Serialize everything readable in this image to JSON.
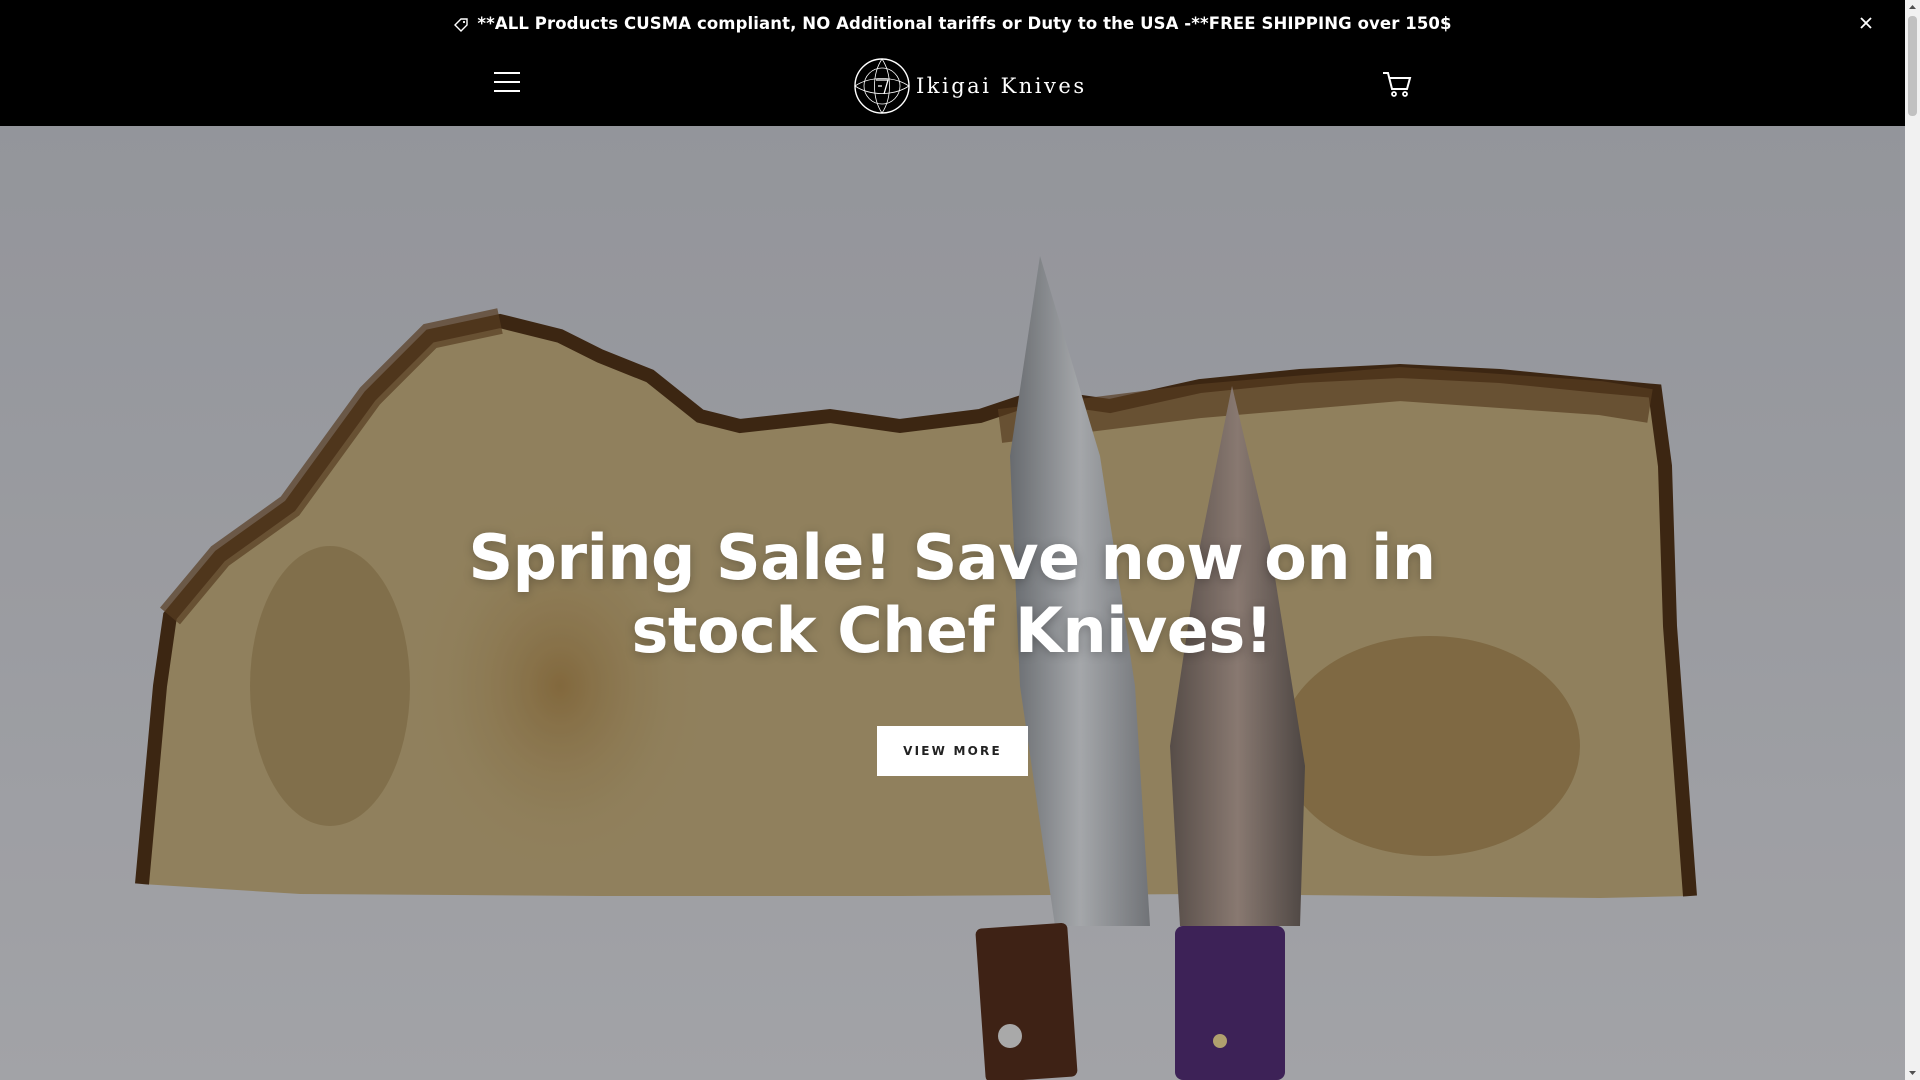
{
  "announcement": {
    "icon": "tag-icon",
    "text": "**ALL Products CUSMA compliant, NO Additional tariffs or Duty to the USA -**FREE SHIPPING over 150$",
    "close_icon": "close-icon"
  },
  "header": {
    "menu_icon": "hamburger-menu-icon",
    "logo_text": "Ikigai Knives",
    "cart_icon": "cart-icon"
  },
  "hero": {
    "title": "Spring Sale! Save now on in stock Chef Knives!",
    "button_label": "VIEW MORE"
  },
  "colors": {
    "header_bg": "#000000",
    "text_light": "#ffffff",
    "button_bg": "#ffffff",
    "wood_light": "#b8a377",
    "wood_dark": "#5a3b1d"
  }
}
